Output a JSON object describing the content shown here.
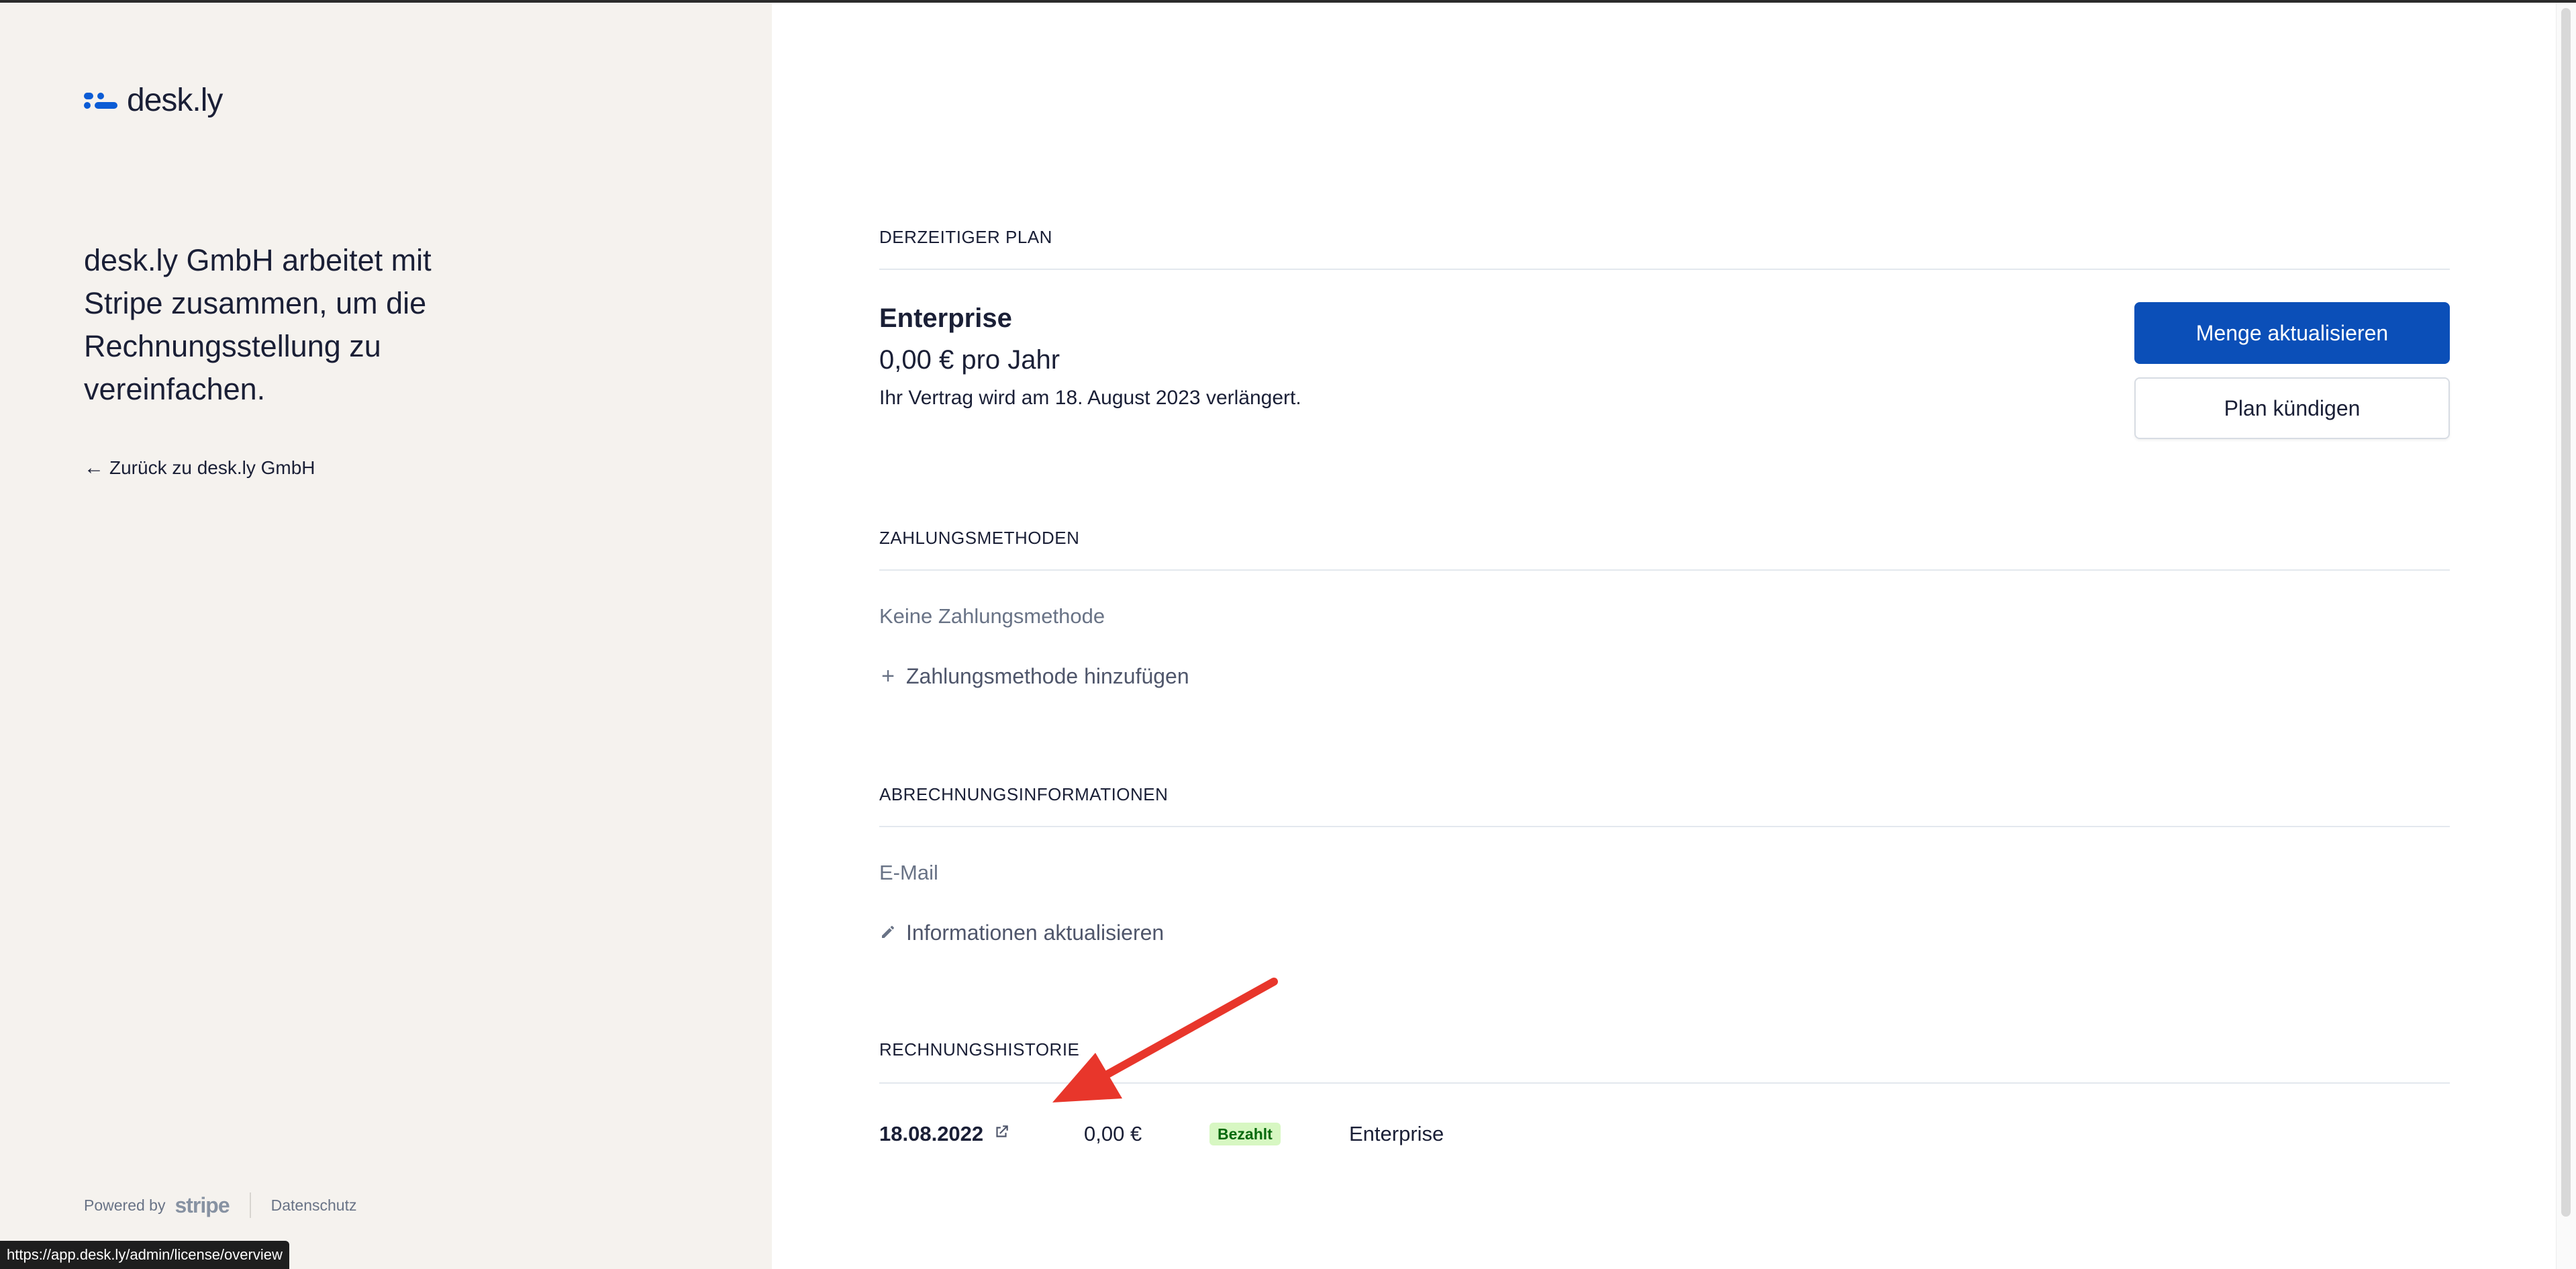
{
  "brand": {
    "name": "desk.ly",
    "accent": "#0b5cd5"
  },
  "left": {
    "lead": "desk.ly GmbH arbeitet mit Stripe zusammen, um die Rechnungsstellung zu vereinfachen.",
    "back_link": "Zurück zu desk.ly GmbH",
    "footer": {
      "powered_by": "Powered by",
      "stripe": "stripe",
      "privacy": "Datenschutz"
    }
  },
  "status_url": "https://app.desk.ly/admin/license/overview",
  "current_plan": {
    "section_title": "DERZEITIGER PLAN",
    "name": "Enterprise",
    "price": "0,00 € pro Jahr",
    "renewal": "Ihr Vertrag wird am 18. August 2023 verlängert.",
    "update_button": "Menge aktualisieren",
    "cancel_button": "Plan kündigen"
  },
  "payment_methods": {
    "section_title": "ZAHLUNGSMETHODEN",
    "empty": "Keine Zahlungsmethode",
    "add_link": "Zahlungsmethode hinzufügen"
  },
  "billing_info": {
    "section_title": "ABRECHNUNGSINFORMATIONEN",
    "email_label": "E-Mail",
    "update_link": "Informationen aktualisieren"
  },
  "invoice_history": {
    "section_title": "RECHNUNGSHISTORIE",
    "rows": [
      {
        "date": "18.08.2022",
        "amount": "0,00 €",
        "status": "Bezahlt",
        "plan": "Enterprise"
      }
    ]
  },
  "colors": {
    "primary_button": "#0b4fb8",
    "badge_bg": "#d7f7c2",
    "badge_text": "#05690d",
    "annotation_arrow": "#e8362b"
  }
}
